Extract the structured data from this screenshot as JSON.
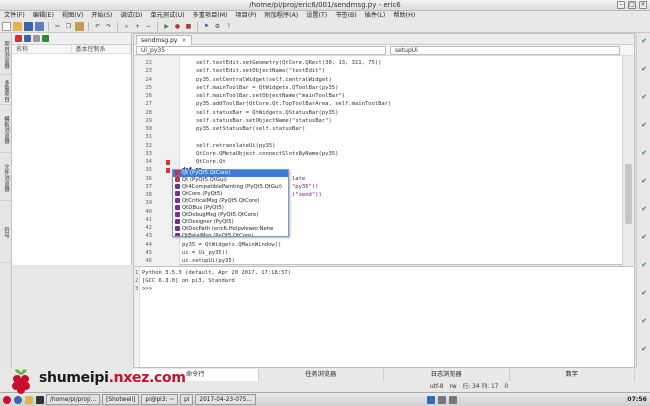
{
  "window": {
    "title": "/home/pi/proj/eric6/001/sendmsg.py - eric6"
  },
  "menus": [
    "文件(F)",
    "编辑(E)",
    "视图(V)",
    "开始(S)",
    "调试(D)",
    "单元测试(U)",
    "多重项目(M)",
    "项目(P)",
    "附加程序(A)",
    "设置(T)",
    "书签(B)",
    "插件(L)",
    "帮助(H)"
  ],
  "left_tabs": [
    "项目浏览器",
    "多重项目浏览器",
    "模板浏览器",
    "文件浏览器",
    "符号"
  ],
  "browser": {
    "col1": "名称",
    "col2": "基本控制系"
  },
  "editor": {
    "tab_label": "sendmsg.py",
    "combo_left": "Ui_py35",
    "combo_right": "setupUi",
    "lines": [
      {
        "n": "22",
        "t": "self.textEdit.setGeometry(QtCore.QRect(30, 13, 311, 75))"
      },
      {
        "n": "23",
        "t": "self.textEdit.setObjectName(\"textEdit\")"
      },
      {
        "n": "24",
        "t": "py35.setCentralWidget(self.centralWidget)"
      },
      {
        "n": "25",
        "t": "self.mainToolBar = QtWidgets.QToolBar(py35)"
      },
      {
        "n": "26",
        "t": "self.mainToolBar.setObjectName(\"mainToolBar\")"
      },
      {
        "n": "27",
        "t": "py35.addToolBar(QtCore.Qt.TopToolBarArea, self.mainToolBar)"
      },
      {
        "n": "28",
        "t": "self.statusBar = QtWidgets.QStatusBar(py35)"
      },
      {
        "n": "29",
        "t": "self.statusBar.setObjectName(\"statusBar\")"
      },
      {
        "n": "30",
        "t": "py35.setStatusBar(self.statusBar)"
      },
      {
        "n": "31",
        "t": ""
      },
      {
        "n": "32",
        "t": "self.retranslateUi(py35)"
      },
      {
        "n": "33",
        "t": "QtCore.QMetaObject.connectSlotsByName(py35)"
      },
      {
        "n": "34",
        "t": "QtCore.Qt"
      },
      {
        "n": "35",
        "t": "def re"
      },
      {
        "n": "36",
        "t": "_tra"
      },
      {
        "n": "37",
        "t": "py3"
      },
      {
        "n": "38",
        "t": "self"
      },
      {
        "n": "39",
        "t": ""
      },
      {
        "n": "40",
        "t": ""
      },
      {
        "n": "41",
        "t": "if __name_"
      },
      {
        "n": "42",
        "t": "impor"
      },
      {
        "n": "43",
        "t": "app ="
      },
      {
        "n": "44",
        "t": "py35 = QtWidgets.QMainWindow()"
      },
      {
        "n": "45",
        "t": "ui = Ui_py35()"
      },
      {
        "n": "46",
        "t": "ui.setupUi(py35)"
      }
    ],
    "fragments": {
      "l36": "late",
      "l37": "\"py35\"))",
      "l38": "(\"send\"))"
    }
  },
  "autocomplete": [
    "Qt (PyQt5.QtCore)",
    "Qt (PyQt5.QtGui)",
    "Qt4CompatiblePainting (PyQt5.QtGui)",
    "QtCore (PyQt5)",
    "QtCriticalMsg (PyQt5.QtCore)",
    "QtDBus (PyQt5)",
    "QtDebugMsg (PyQt5.QtCore)",
    "QtDesigner (PyQt5)",
    "QtDocPath (eric6.Helpviewer.Netw",
    "QtFatalMsg (PyQt5.QtCore)"
  ],
  "shell": {
    "lines": [
      "Python 3.5.3 (default, Apr 20 2017, 17:18:57)",
      "[GCC 6.3.0] on pi3, Standard",
      ">>>"
    ],
    "line_nums": [
      "1",
      "2",
      "3"
    ]
  },
  "bottom_tabs": [
    "命令行",
    "任务浏览器",
    "日志浏览器",
    "数字"
  ],
  "status": {
    "encoding": "utf-8",
    "mode": "rw",
    "line_label": "行: 34 列: 17",
    "zoom": "0"
  },
  "taskbar": {
    "tasks": [
      "/home/pi/proj/...",
      "[Shotwell]",
      "pi@pi3: ~",
      "pi",
      "2017-04-23-075..."
    ],
    "clock": "07:56"
  },
  "watermark": {
    "brand": "shumeipi",
    "tld": ".nxez.com"
  }
}
